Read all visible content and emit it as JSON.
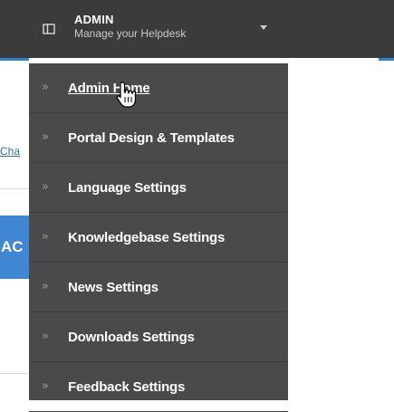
{
  "header": {
    "title": "ADMIN",
    "subtitle": "Manage your Helpdesk",
    "icon": "columns-icon",
    "caret_icon": "caret-down-icon"
  },
  "menu": {
    "chevron": "»",
    "items": [
      {
        "label": "Admin Home",
        "active": true
      },
      {
        "label": "Portal Design & Templates"
      },
      {
        "label": "Language Settings"
      },
      {
        "label": "Knowledgebase Settings"
      },
      {
        "label": "News Settings"
      },
      {
        "label": "Downloads Settings"
      },
      {
        "label": "Feedback Settings"
      }
    ]
  },
  "background": {
    "link_text": "Cha",
    "button_text": "AC"
  },
  "colors": {
    "topbar": "#3b3b3b",
    "menu_bg": "#4a4a4a",
    "accent": "#2d7fd3"
  }
}
